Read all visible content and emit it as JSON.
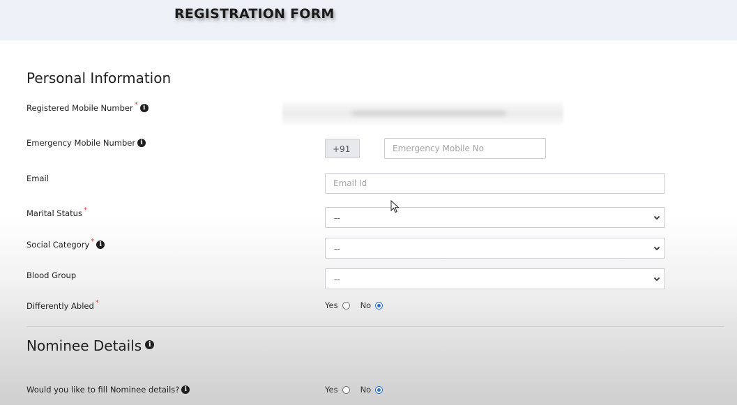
{
  "header": {
    "title": "REGISTRATION FORM"
  },
  "personal": {
    "title": "Personal Information",
    "registered_mobile": {
      "label": "Registered Mobile Number",
      "required": "*"
    },
    "emergency_mobile": {
      "label": "Emergency Mobile Number",
      "prefix": "+91",
      "placeholder": "Emergency Mobile No"
    },
    "email": {
      "label": "Email",
      "placeholder": "Email Id"
    },
    "marital_status": {
      "label": "Marital Status",
      "required": "*",
      "value": "--"
    },
    "social_category": {
      "label": "Social Category",
      "required": "*",
      "value": "--"
    },
    "blood_group": {
      "label": "Blood Group",
      "value": "--"
    },
    "differently_abled": {
      "label": "Differently Abled",
      "required": "*",
      "yes": "Yes",
      "no": "No",
      "selected": "No"
    }
  },
  "nominee": {
    "title": "Nominee Details",
    "fill_nominee": {
      "label": "Would you like to fill Nominee details?",
      "yes": "Yes",
      "no": "No",
      "selected": "No"
    }
  },
  "icons": {
    "info": "info-icon",
    "dropdown": "chevron-down-icon",
    "cursor": "mouse-pointer-icon"
  },
  "colors": {
    "header_bg": "#edf1f7",
    "required": "#e23a3a",
    "radio_selected": "#2b6fd6"
  }
}
